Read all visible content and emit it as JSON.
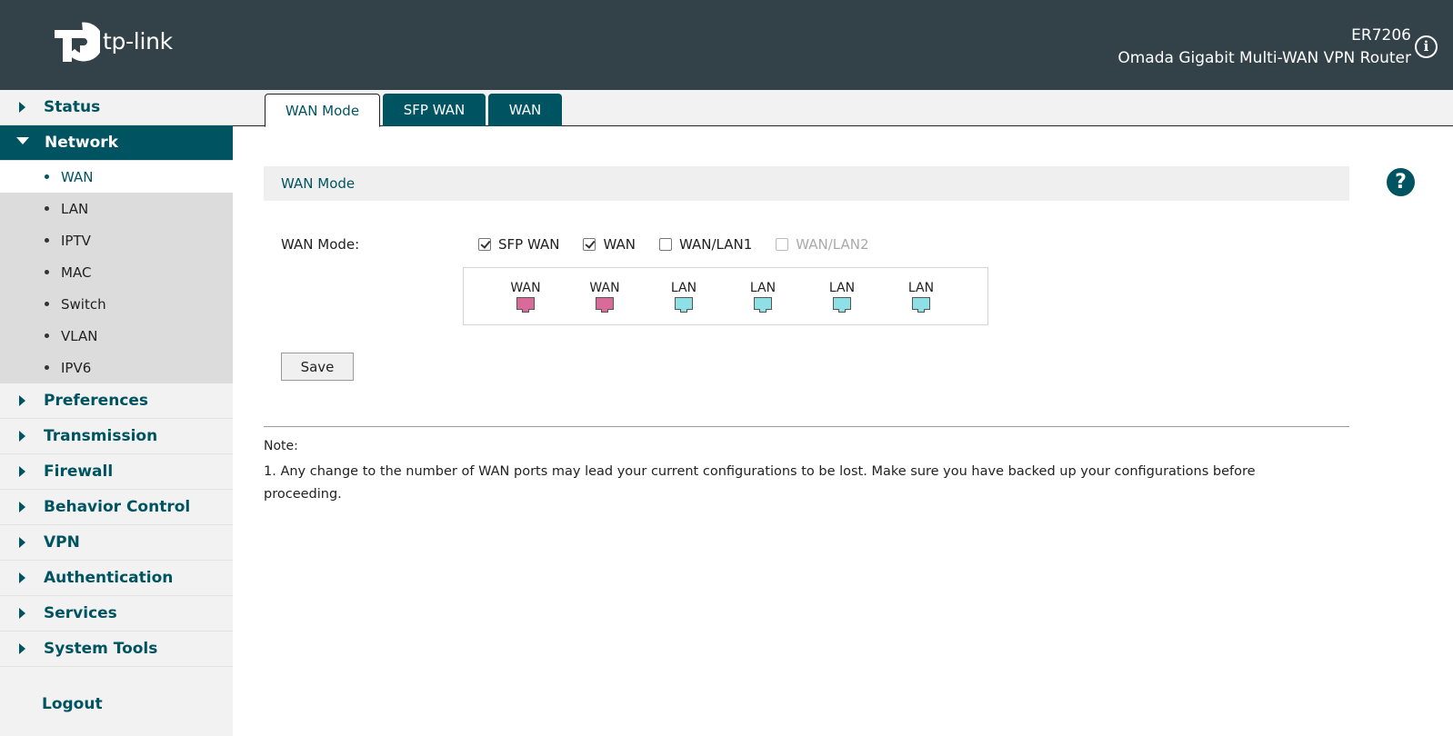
{
  "header": {
    "brand": "tp-link",
    "model": "ER7206",
    "description": "Omada Gigabit Multi-WAN VPN Router",
    "info_glyph": "i"
  },
  "sidebar": {
    "items": [
      {
        "label": "Status"
      },
      {
        "label": "Network"
      },
      {
        "label": "Preferences"
      },
      {
        "label": "Transmission"
      },
      {
        "label": "Firewall"
      },
      {
        "label": "Behavior Control"
      },
      {
        "label": "VPN"
      },
      {
        "label": "Authentication"
      },
      {
        "label": "Services"
      },
      {
        "label": "System Tools"
      }
    ],
    "network_sub": [
      "WAN",
      "LAN",
      "IPTV",
      "MAC",
      "Switch",
      "VLAN",
      "IPV6"
    ],
    "logout": "Logout"
  },
  "tabs": [
    {
      "label": "WAN Mode"
    },
    {
      "label": "SFP WAN"
    },
    {
      "label": "WAN"
    }
  ],
  "section": {
    "title": "WAN Mode",
    "help_glyph": "?"
  },
  "form": {
    "wan_mode_label": "WAN Mode:",
    "options": [
      {
        "label": "SFP WAN",
        "checked": true,
        "disabled": false
      },
      {
        "label": "WAN",
        "checked": true,
        "disabled": false
      },
      {
        "label": "WAN/LAN1",
        "checked": false,
        "disabled": false
      },
      {
        "label": "WAN/LAN2",
        "checked": false,
        "disabled": true
      }
    ],
    "ports": [
      {
        "label": "WAN",
        "type": "wan"
      },
      {
        "label": "WAN",
        "type": "wan"
      },
      {
        "label": "LAN",
        "type": "lan"
      },
      {
        "label": "LAN",
        "type": "lan"
      },
      {
        "label": "LAN",
        "type": "lan"
      },
      {
        "label": "LAN",
        "type": "lan"
      }
    ],
    "save_label": "Save"
  },
  "note": {
    "title": "Note:",
    "text": "1. Any change to the number of WAN ports may lead your current configurations to be lost. Make sure you have backed up your configurations before proceeding."
  },
  "colors": {
    "header_bg": "#334249",
    "accent": "#005461",
    "wan_port": "#d96b9a",
    "lan_port": "#8ee0e6"
  }
}
